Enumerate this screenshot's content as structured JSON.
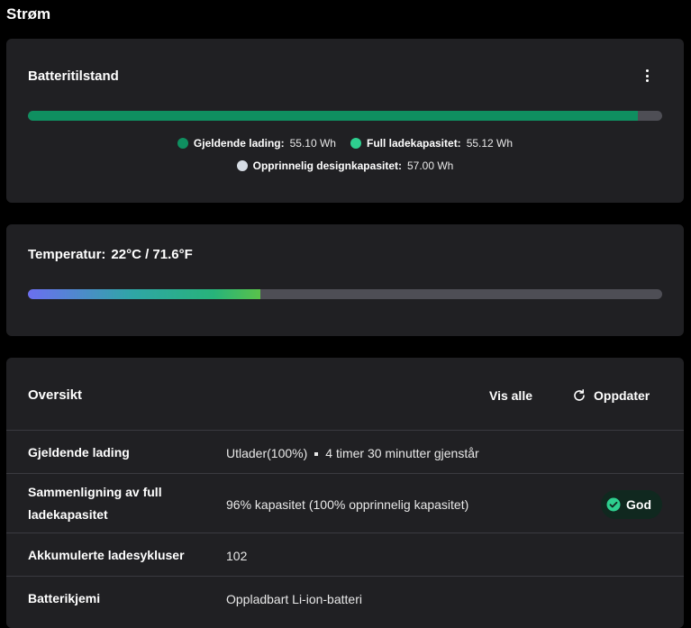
{
  "page": {
    "title": "Strøm"
  },
  "battery": {
    "title": "Batteritilstand",
    "fill_fraction": 0.962,
    "legend": [
      {
        "label": "Gjeldende lading:",
        "value": "55.10 Wh",
        "color": "#0f8f60"
      },
      {
        "label": "Full ladekapasitet:",
        "value": "55.12 Wh",
        "color": "#2ecf8f"
      },
      {
        "label": "Opprinnelig designkapasitet:",
        "value": "57.00 Wh",
        "color": "#d6dce4"
      }
    ]
  },
  "temperature": {
    "label": "Temperatur:",
    "value": "22°C / 71.6°F",
    "fill_fraction": 0.366
  },
  "overview": {
    "title": "Oversikt",
    "view_all_label": "Vis alle",
    "refresh_label": "Oppdater",
    "rows": [
      {
        "label": "Gjeldende lading",
        "value": "Utlader(100%)",
        "extra": "4 timer 30 minutter gjenstår"
      },
      {
        "label": "Sammenligning av full ladekapasitet",
        "value": "96% kapasitet (100% opprinnelig kapasitet)",
        "badge": "God"
      },
      {
        "label": "Akkumulerte ladesykluser",
        "value": "102"
      },
      {
        "label": "Batterikjemi",
        "value": "Oppladbart Li-ion-batteri"
      }
    ]
  },
  "colors": {
    "accent_green": "#0f8f60",
    "badge_green": "#2ecf8f",
    "card_bg": "#202023"
  }
}
